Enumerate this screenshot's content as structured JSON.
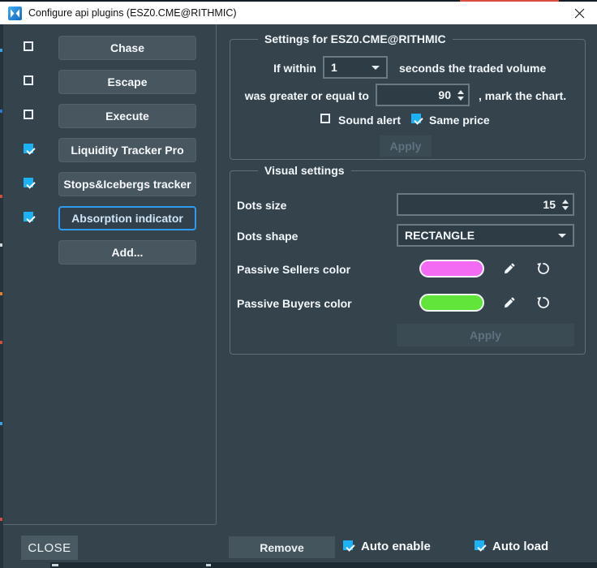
{
  "window": {
    "title": "Configure api plugins (ESZ0.CME@RITHMIC)"
  },
  "plugins": {
    "items": [
      {
        "label": "Chase",
        "checked": false,
        "selected": false
      },
      {
        "label": "Escape",
        "checked": false,
        "selected": false
      },
      {
        "label": "Execute",
        "checked": false,
        "selected": false
      },
      {
        "label": "Liquidity Tracker Pro",
        "checked": true,
        "selected": false
      },
      {
        "label": "Stops&Icebergs tracker",
        "checked": true,
        "selected": false
      },
      {
        "label": "Absorption indicator",
        "checked": true,
        "selected": true
      },
      {
        "label": "Add...",
        "selected": false
      }
    ]
  },
  "settings": {
    "title": "Settings for ESZ0.CME@RITHMIC",
    "row1": {
      "prefix": "If within",
      "value": "1",
      "suffix": "seconds the traded volume"
    },
    "row2": {
      "prefix": "was greater or equal to",
      "value": "90",
      "suffix": ", mark the chart."
    },
    "sound_alert": {
      "label": "Sound alert",
      "checked": false
    },
    "same_price": {
      "label": "Same price",
      "checked": true
    },
    "apply_label": "Apply"
  },
  "visual": {
    "title": "Visual settings",
    "dots_size": {
      "label": "Dots size",
      "value": "15"
    },
    "dots_shape": {
      "label": "Dots shape",
      "value": "RECTANGLE"
    },
    "sellers": {
      "label": "Passive Sellers color",
      "color": "#f36bf3"
    },
    "buyers": {
      "label": "Passive Buyers color",
      "color": "#62e53b"
    },
    "apply_label": "Apply"
  },
  "footer": {
    "close_label": "CLOSE",
    "remove_label": "Remove",
    "auto_enable": {
      "label": "Auto enable",
      "checked": true
    },
    "auto_load": {
      "label": "Auto load",
      "checked": true
    }
  },
  "colors": {
    "accent_checkbox": "#1db2f5",
    "selected_button_border": "#2d9bf0",
    "titlebar_bg": "#ffffff",
    "dialog_bg": "#35434c",
    "button_bg": "#47565f",
    "passive_sellers": "#f36bf3",
    "passive_buyers": "#62e53b"
  }
}
